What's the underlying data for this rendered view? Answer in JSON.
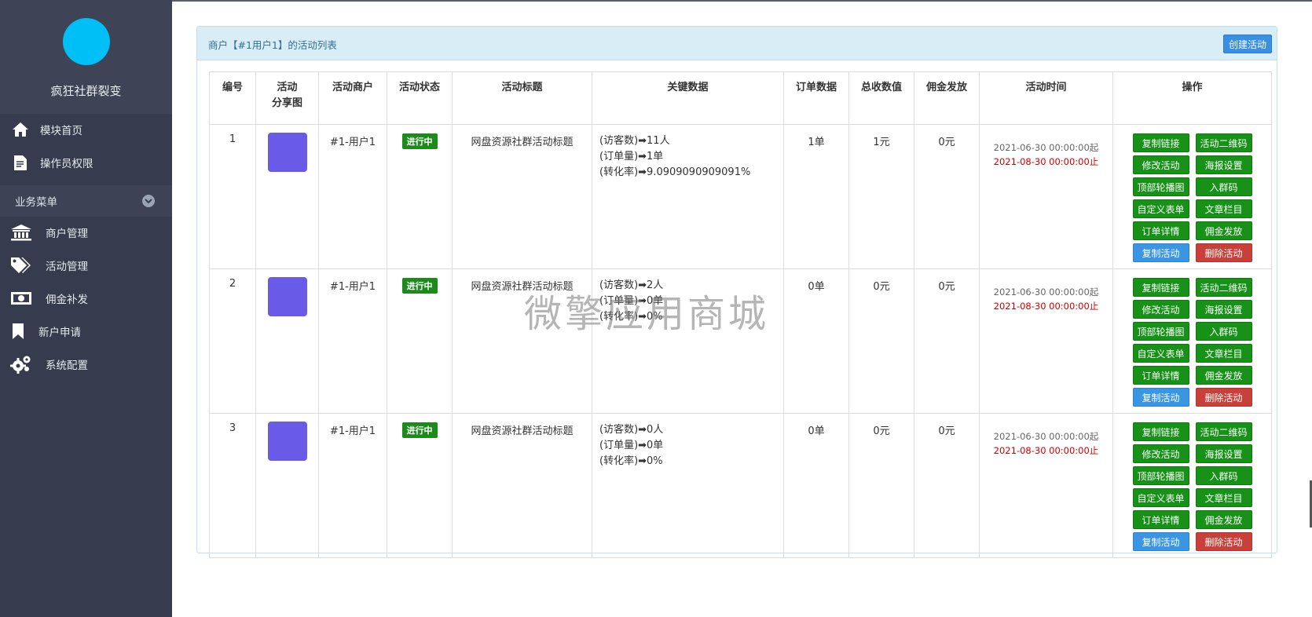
{
  "sidebar": {
    "brand_name": "疯狂社群裂变",
    "nav_top": [
      {
        "label": "模块首页",
        "icon": "home-icon"
      },
      {
        "label": "操作员权限",
        "icon": "document-icon"
      }
    ],
    "section_label": "业务菜单",
    "nav_business": [
      {
        "label": "商户管理",
        "icon": "bank-icon"
      },
      {
        "label": "活动管理",
        "icon": "tags-icon"
      },
      {
        "label": "佣金补发",
        "icon": "money-icon"
      },
      {
        "label": "新户申请",
        "icon": "bookmark-icon"
      },
      {
        "label": "系统配置",
        "icon": "gears-icon"
      }
    ]
  },
  "panel": {
    "title": "商户【#1用户1】的活动列表",
    "create_button": "创建活动"
  },
  "table": {
    "headers": {
      "id": "编号",
      "share_line1": "活动",
      "share_line2": "分享图",
      "merchant": "活动商户",
      "status": "活动状态",
      "title": "活动标题",
      "key_data": "关键数据",
      "orders": "订单数据",
      "revenue": "总收数值",
      "commission": "佣金发放",
      "time": "活动时间",
      "actions": "操作"
    },
    "rows": [
      {
        "id": "1",
        "merchant": "#1-用户1",
        "status": "进行中",
        "title": "网盘资源社群活动标题",
        "visitors": "(访客数)➡11人",
        "order_count": "(订单量)➡1单",
        "conversion": "(转化率)➡9.0909090909091%",
        "orders": "1单",
        "revenue": "1元",
        "commission": "0元",
        "start": "2021-06-30 00:00:00起",
        "end": "2021-08-30 00:00:00止"
      },
      {
        "id": "2",
        "merchant": "#1-用户1",
        "status": "进行中",
        "title": "网盘资源社群活动标题",
        "visitors": "(访客数)➡2人",
        "order_count": "(订单量)➡0单",
        "conversion": "(转化率)➡0%",
        "orders": "0单",
        "revenue": "0元",
        "commission": "0元",
        "start": "2021-06-30 00:00:00起",
        "end": "2021-08-30 00:00:00止"
      },
      {
        "id": "3",
        "merchant": "#1-用户1",
        "status": "进行中",
        "title": "网盘资源社群活动标题",
        "visitors": "(访客数)➡0人",
        "order_count": "(订单量)➡0单",
        "conversion": "(转化率)➡0%",
        "orders": "0单",
        "revenue": "0元",
        "commission": "0元",
        "start": "2021-06-30 00:00:00起",
        "end": "2021-08-30 00:00:00止"
      }
    ],
    "actions": {
      "copy_link": "复制链接",
      "qrcode": "活动二维码",
      "edit": "修改活动",
      "poster": "海报设置",
      "carousel": "顶部轮播图",
      "join_group": "入群码",
      "custom_form": "自定义表单",
      "article": "文章栏目",
      "order_detail": "订单详情",
      "commission": "佣金发放",
      "copy_activity": "复制活动",
      "delete": "删除活动"
    }
  },
  "watermark": "微擎应用商城",
  "colors": {
    "sidebar_bg": "#363c4d",
    "avatar": "#00bff6",
    "badge_green": "#1e8a1e",
    "action_green": "#179117",
    "action_blue": "#3a95e3",
    "action_red": "#c9403a",
    "end_time_red": "#cc0000",
    "panel_header": "#d9edf7"
  }
}
